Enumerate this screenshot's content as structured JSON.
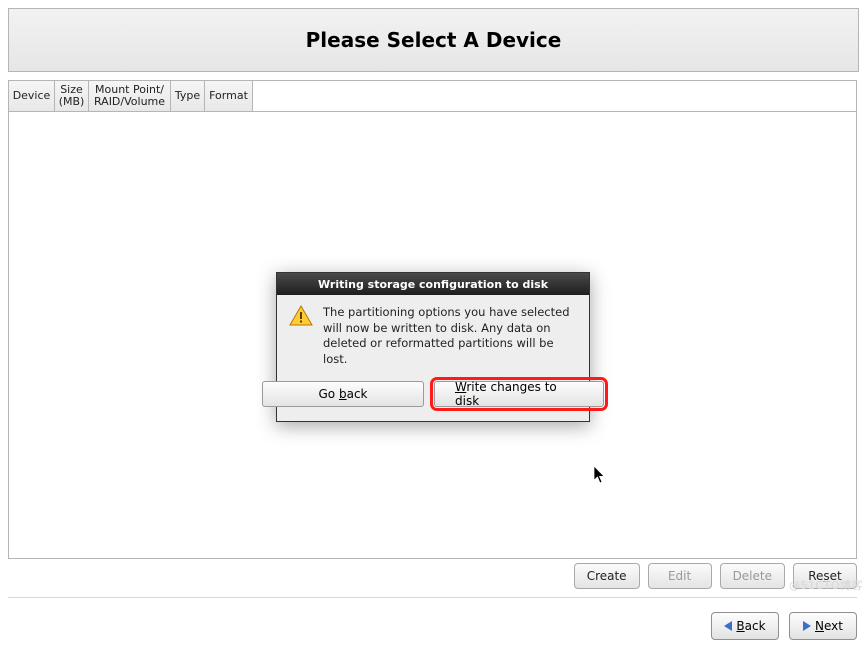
{
  "banner": {
    "title": "Please Select A Device"
  },
  "table": {
    "columns": [
      "Device",
      "Size\n(MB)",
      "Mount Point/\nRAID/Volume",
      "Type",
      "Format"
    ]
  },
  "actions": {
    "create": "Create",
    "edit": "Edit",
    "delete": "Delete",
    "reset": "Reset"
  },
  "nav": {
    "back": "Back",
    "next": "Next"
  },
  "dialog": {
    "title": "Writing storage configuration to disk",
    "message": "The partitioning options you have selected will now be written to disk.  Any data on deleted or reformatted partitions will be lost.",
    "go_back": "Go back",
    "write_pre": "W",
    "write_post": "rite changes to disk",
    "go_back_mid_u": "b",
    "go_back_pre": "Go ",
    "go_back_post": "ack"
  },
  "watermark": "@51CTO博客"
}
